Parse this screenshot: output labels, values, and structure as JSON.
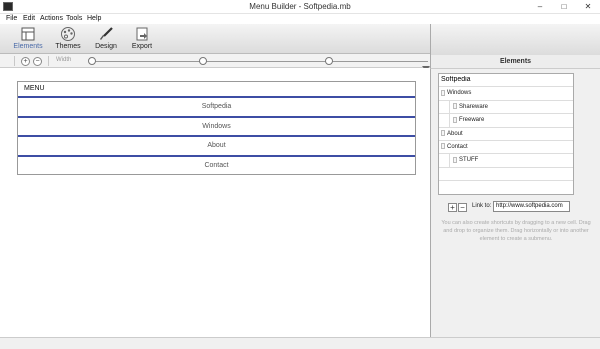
{
  "window": {
    "title": "Menu Builder - Softpedia.mb",
    "minimize_glyph": "–",
    "maximize_glyph": "□",
    "close_glyph": "✕"
  },
  "menubar": {
    "items": [
      "File",
      "Edit",
      "Actions",
      "Tools",
      "Help"
    ]
  },
  "ribbon": {
    "buttons": [
      {
        "label": "Elements",
        "icon": "elements-grid-icon",
        "active": true
      },
      {
        "label": "Themes",
        "icon": "palette-icon",
        "active": false
      },
      {
        "label": "Design",
        "icon": "brush-icon",
        "active": false
      },
      {
        "label": "Export",
        "icon": "export-icon",
        "active": false
      }
    ]
  },
  "toolbar": {
    "zoom_in_glyph": "+",
    "zoom_out_glyph": "−",
    "label": "Width"
  },
  "canvas": {
    "menu_title": "MENU",
    "menu_items": [
      "Softpedia",
      "Windows",
      "About",
      "Contact"
    ],
    "accent_color": "#3d4ea4"
  },
  "elements_panel": {
    "title": "Elements",
    "tree": [
      {
        "label": "Softpedia",
        "level": 0,
        "editing": true
      },
      {
        "label": "Windows",
        "level": 0
      },
      {
        "label": "Shareware",
        "level": 1
      },
      {
        "label": "Freeware",
        "level": 1
      },
      {
        "label": "About",
        "level": 0
      },
      {
        "label": "Contact",
        "level": 0
      },
      {
        "label": "STUFF",
        "level": 1
      }
    ],
    "add_glyph": "+",
    "remove_glyph": "−",
    "link_label": "Link to:",
    "link_value": "http://www.softpedia.com",
    "help_text": "You can also create shortcuts by dragging to a new cell. Drag and drop to organize them. Drag horizontally or into another element to create a submenu."
  }
}
